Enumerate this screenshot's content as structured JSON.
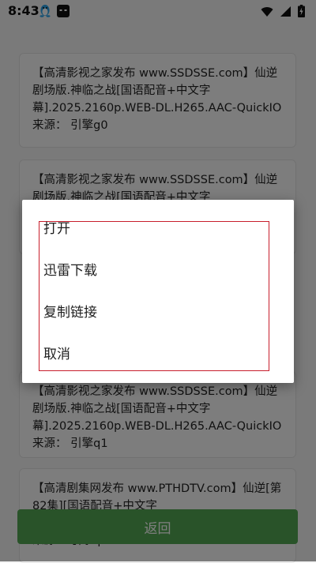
{
  "status_bar": {
    "time": "8:43"
  },
  "list": {
    "items": [
      {
        "title": "【高清影视之家发布 www.SSDSSE.com】仙逆剧场版.神临之战[国语配音+中文字幕].2025.2160p.WEB-DL.H265.AAC-QuickIO",
        "source": "来源：  引擎g0"
      },
      {
        "title": "【高清影视之家发布 www.SSDSSE.com】仙逆剧场版.神临之战[国语配音+中文字幕].2025.2160p.WEB-DL.H265.AAC-QuickIO",
        "source": ""
      },
      {
        "title": "【高清影视之家发布 www.SSDSSE.com】仙逆剧场版.神临之战[国语配音+中文字幕].2025.2160p.WEB-DL.H265.AAC-QuickIO",
        "source": "来源：  引擎q1"
      },
      {
        "title": "【高清剧集网发布 www.PTHDTV.com】仙逆[第82集][国语配音+中文字",
        "source": "来源：  引擎q1"
      }
    ]
  },
  "back_button": {
    "label": "返回"
  },
  "dialog": {
    "items": [
      {
        "label": "打开"
      },
      {
        "label": "迅雷下载"
      },
      {
        "label": "复制链接"
      },
      {
        "label": "取消"
      }
    ]
  },
  "colors": {
    "accent_green": "#53a653",
    "highlight_red": "#c81e2c",
    "scrim": "rgba(0,0,0,0.5)"
  },
  "icons": [
    "qq-penguin-icon",
    "app-cat-icon",
    "wifi-icon",
    "signal-icon",
    "battery-charging-icon"
  ]
}
